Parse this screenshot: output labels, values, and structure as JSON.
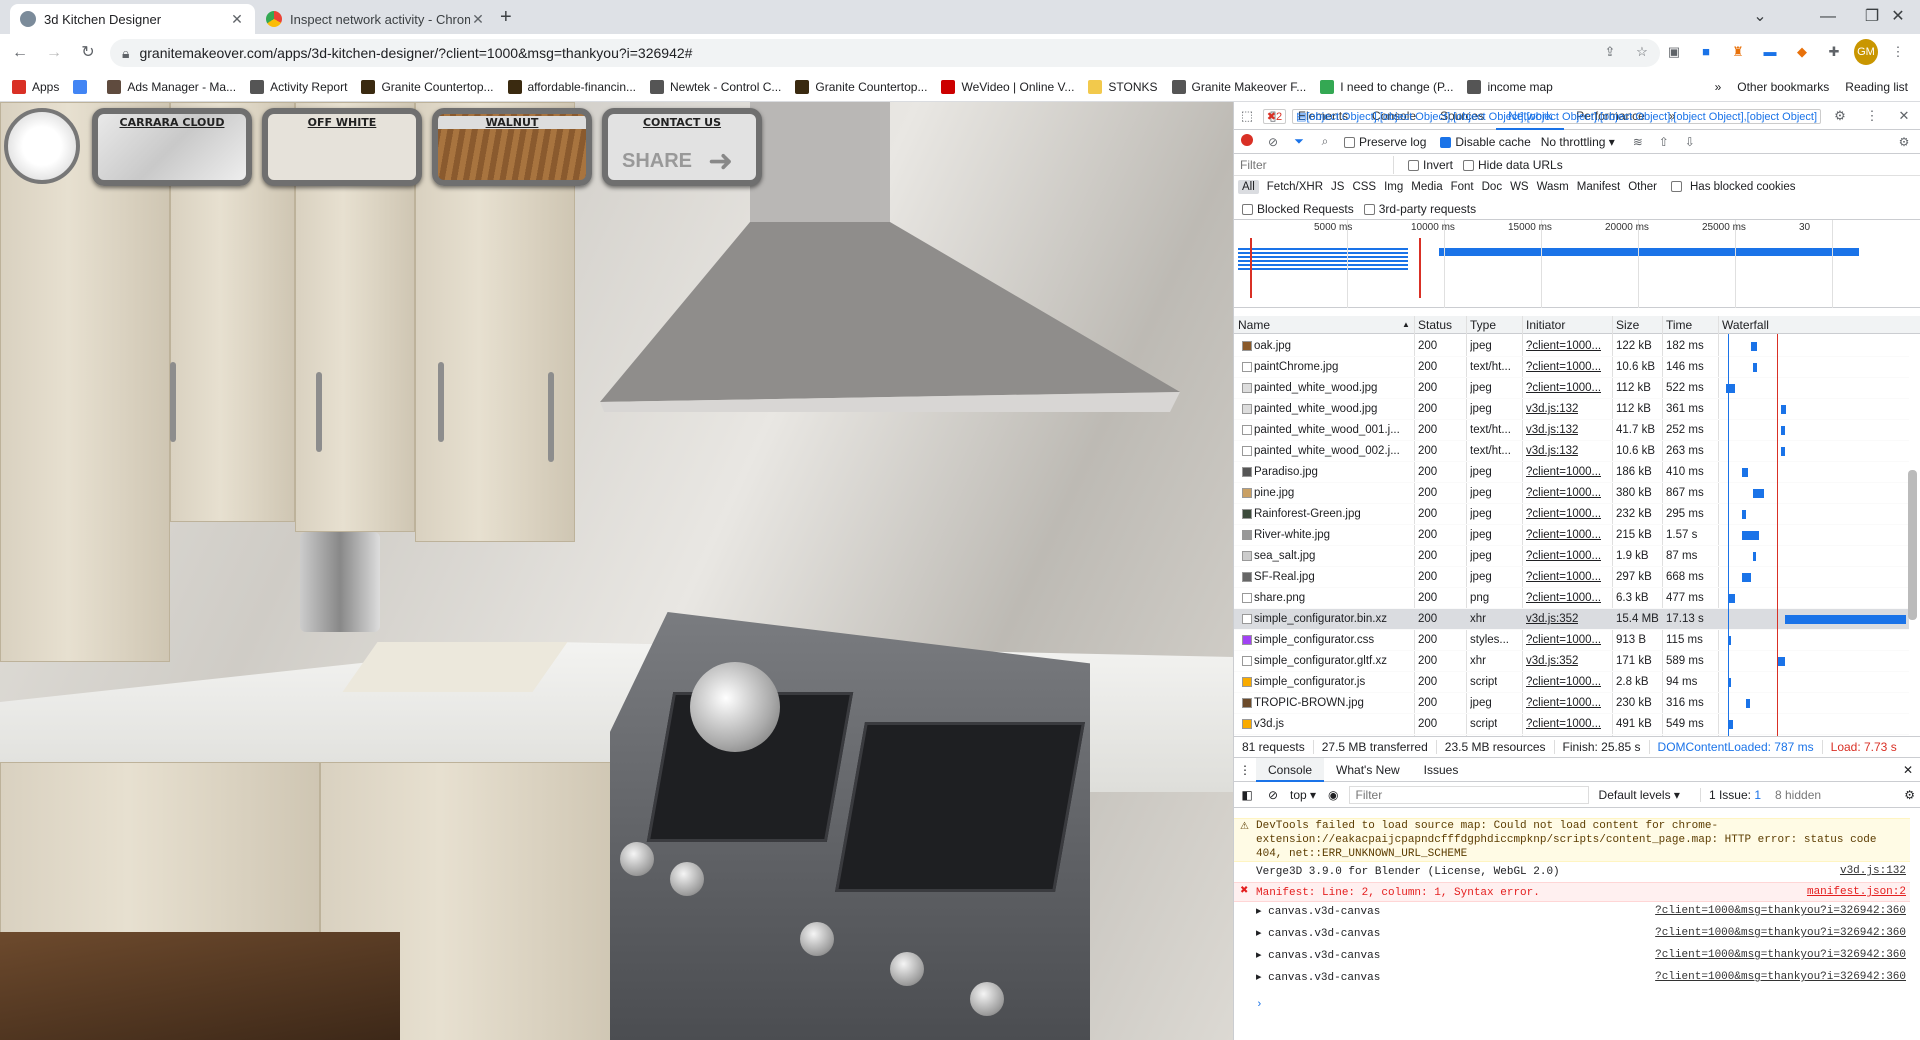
{
  "tabs": [
    {
      "title": "3d Kitchen Designer",
      "close": "✕"
    },
    {
      "title": "Inspect network activity - Chrome",
      "close": "✕"
    }
  ],
  "new_tab": "+",
  "window_controls": {
    "minimize": "⌄",
    "min": "—",
    "restore": "❐",
    "close": "✕"
  },
  "url": "granitemakeover.com/apps/3d-kitchen-designer/?client=1000&msg=thankyou?i=326942#",
  "bookmarks": [
    {
      "label": "Apps",
      "color": "#d93025"
    },
    {
      "label": "",
      "color": "#4285f4"
    },
    {
      "label": "Ads Manager - Ma...",
      "color": "#5f4b3e"
    },
    {
      "label": "Activity Report",
      "color": "#555"
    },
    {
      "label": "Granite Countertop...",
      "color": "#3a2a10"
    },
    {
      "label": "affordable-financin...",
      "color": "#3a2a10"
    },
    {
      "label": "Newtek - Control C...",
      "color": "#555"
    },
    {
      "label": "Granite Countertop...",
      "color": "#3a2a10"
    },
    {
      "label": "WeVideo | Online V...",
      "color": "#c00"
    },
    {
      "label": "STONKS",
      "color": "#f2c94c"
    },
    {
      "label": "Granite Makeover F...",
      "color": "#555"
    },
    {
      "label": "I need to change (P...",
      "color": "#34a853"
    },
    {
      "label": "income map",
      "color": "#555"
    }
  ],
  "bookmark_right": {
    "more": "»",
    "other": "Other bookmarks",
    "reading": "Reading list"
  },
  "scene": {
    "buttons": [
      {
        "label": "CARRARA CLOUD"
      },
      {
        "label": "OFF WHITE"
      },
      {
        "label": "WALNUT"
      },
      {
        "label": "CONTACT US",
        "extra": "SHARE"
      }
    ]
  },
  "devtools": {
    "tabs": [
      "Elements",
      "Console",
      "Sources",
      "Network",
      "Performance",
      "»"
    ],
    "active_tab": "Network",
    "errors": "2",
    "messages": [
      {
        "kind": "warn",
        "text": "DevTools failed to load source map: Could not load content for chrome-extension://eakacpaijcpapndcfffdgphdiccmpknp/scripts/content_page.map: HTTP error: status code 404, net::ERR_UNKNOWN_URL_SCHEME",
        "src": ""
      },
      {
        "kind": "info",
        "text": "Verge3D 3.9.0 for Blender (License, WebGL 2.0)",
        "src": "v3d.js:132"
      },
      {
        "kind": "err",
        "text": "Manifest: Line: 2, column: 1, Syntax error.",
        "src": "manifest.json:2"
      },
      {
        "kind": "info",
        "text": "▸ canvas.v3d-canvas",
        "src": "?client=1000&msg=thankyou?i=326942:360"
      },
      {
        "kind": "info",
        "text": "▸ canvas.v3d-canvas",
        "src": "?client=1000&msg=thankyou?i=326942:360"
      },
      {
        "kind": "info",
        "text": "▸ canvas.v3d-canvas",
        "src": "?client=1000&msg=thankyou?i=326942:360"
      },
      {
        "kind": "info",
        "text": "▸ canvas.v3d-canvas",
        "src": "?client=1000&msg=thankyou?i=326942:360"
      }
    ],
    "toolbar": {
      "preserve_log": "Preserve log",
      "disable_cache": "Disable cache",
      "throttling": "No throttling"
    },
    "filter_placeholder": "Filter",
    "invert": "Invert",
    "hide_data": "Hide data URLs",
    "types": [
      "All",
      "Fetch/XHR",
      "JS",
      "CSS",
      "Img",
      "Media",
      "Font",
      "Doc",
      "WS",
      "Wasm",
      "Manifest",
      "Other"
    ],
    "has_blocked": "Has blocked cookies",
    "blocked_requests": "Blocked Requests",
    "third_party": "3rd-party requests",
    "overview_ticks": [
      "5000 ms",
      "10000 ms",
      "15000 ms",
      "20000 ms",
      "25000 ms",
      "30"
    ],
    "columns": [
      "Name",
      "Status",
      "Type",
      "Initiator",
      "Size",
      "Time",
      "Waterfall"
    ],
    "rows": [
      {
        "name": "oak.jpg",
        "status": "200",
        "type": "jpeg",
        "initiator": "?client=1000...",
        "size": "122 kB",
        "time": "182 ms",
        "icon": "#8a5a2b",
        "wf_start": 0.16,
        "wf_len": 0.03
      },
      {
        "name": "paintChrome.jpg",
        "status": "200",
        "type": "text/ht...",
        "initiator": "?client=1000...",
        "size": "10.6 kB",
        "time": "146 ms",
        "icon": "#fff",
        "wf_start": 0.17,
        "wf_len": 0.02
      },
      {
        "name": "painted_white_wood.jpg",
        "status": "200",
        "type": "jpeg",
        "initiator": "?client=1000...",
        "size": "112 kB",
        "time": "522 ms",
        "icon": "#ddd",
        "wf_start": 0.02,
        "wf_len": 0.05
      },
      {
        "name": "painted_white_wood.jpg",
        "status": "200",
        "type": "jpeg",
        "initiator": "v3d.js:132",
        "size": "112 kB",
        "time": "361 ms",
        "icon": "#ddd",
        "wf_start": 0.32,
        "wf_len": 0.03
      },
      {
        "name": "painted_white_wood_001.j...",
        "status": "200",
        "type": "text/ht...",
        "initiator": "v3d.js:132",
        "size": "41.7 kB",
        "time": "252 ms",
        "icon": "#fff",
        "wf_start": 0.32,
        "wf_len": 0.02
      },
      {
        "name": "painted_white_wood_002.j...",
        "status": "200",
        "type": "text/ht...",
        "initiator": "v3d.js:132",
        "size": "10.6 kB",
        "time": "263 ms",
        "icon": "#fff",
        "wf_start": 0.32,
        "wf_len": 0.02
      },
      {
        "name": "Paradiso.jpg",
        "status": "200",
        "type": "jpeg",
        "initiator": "?client=1000...",
        "size": "186 kB",
        "time": "410 ms",
        "icon": "#555",
        "wf_start": 0.11,
        "wf_len": 0.03
      },
      {
        "name": "pine.jpg",
        "status": "200",
        "type": "jpeg",
        "initiator": "?client=1000...",
        "size": "380 kB",
        "time": "867 ms",
        "icon": "#c9a064",
        "wf_start": 0.17,
        "wf_len": 0.06
      },
      {
        "name": "Rainforest-Green.jpg",
        "status": "200",
        "type": "jpeg",
        "initiator": "?client=1000...",
        "size": "232 kB",
        "time": "295 ms",
        "icon": "#3b4a3a",
        "wf_start": 0.11,
        "wf_len": 0.02
      },
      {
        "name": "River-white.jpg",
        "status": "200",
        "type": "jpeg",
        "initiator": "?client=1000...",
        "size": "215 kB",
        "time": "1.57 s",
        "icon": "#999",
        "wf_start": 0.11,
        "wf_len": 0.09
      },
      {
        "name": "sea_salt.jpg",
        "status": "200",
        "type": "jpeg",
        "initiator": "?client=1000...",
        "size": "1.9 kB",
        "time": "87 ms",
        "icon": "#ccc",
        "wf_start": 0.17,
        "wf_len": 0.01
      },
      {
        "name": "SF-Real.jpg",
        "status": "200",
        "type": "jpeg",
        "initiator": "?client=1000...",
        "size": "297 kB",
        "time": "668 ms",
        "icon": "#666",
        "wf_start": 0.11,
        "wf_len": 0.05
      },
      {
        "name": "share.png",
        "status": "200",
        "type": "png",
        "initiator": "?client=1000...",
        "size": "6.3 kB",
        "time": "477 ms",
        "icon": "#fff",
        "wf_start": 0.03,
        "wf_len": 0.04
      },
      {
        "name": "simple_configurator.bin.xz",
        "status": "200",
        "type": "xhr",
        "initiator": "v3d.js:352",
        "size": "15.4 MB",
        "time": "17.13 s",
        "icon": "#fff",
        "wf_start": 0.34,
        "wf_len": 0.66,
        "selected": true
      },
      {
        "name": "simple_configurator.css",
        "status": "200",
        "type": "styles...",
        "initiator": "?client=1000...",
        "size": "913 B",
        "time": "115 ms",
        "icon": "#a142f4",
        "wf_start": 0.03,
        "wf_len": 0.01
      },
      {
        "name": "simple_configurator.gltf.xz",
        "status": "200",
        "type": "xhr",
        "initiator": "v3d.js:352",
        "size": "171 kB",
        "time": "589 ms",
        "icon": "#fff",
        "wf_start": 0.3,
        "wf_len": 0.04
      },
      {
        "name": "simple_configurator.js",
        "status": "200",
        "type": "script",
        "initiator": "?client=1000...",
        "size": "2.8 kB",
        "time": "94 ms",
        "icon": "#f9ab00",
        "wf_start": 0.03,
        "wf_len": 0.01
      },
      {
        "name": "TROPIC-BROWN.jpg",
        "status": "200",
        "type": "jpeg",
        "initiator": "?client=1000...",
        "size": "230 kB",
        "time": "316 ms",
        "icon": "#6b4a2a",
        "wf_start": 0.13,
        "wf_len": 0.02
      },
      {
        "name": "v3d.js",
        "status": "200",
        "type": "script",
        "initiator": "?client=1000...",
        "size": "491 kB",
        "time": "549 ms",
        "icon": "#f9ab00",
        "wf_start": 0.03,
        "wf_len": 0.03
      }
    ],
    "summary": {
      "requests": "81 requests",
      "transferred": "27.5 MB transferred",
      "resources": "23.5 MB resources",
      "finish": "Finish: 25.85 s",
      "dcl": "DOMContentLoaded: 787 ms",
      "load": "Load: 7.73 s"
    },
    "drawer_tabs": [
      "Console",
      "What's New",
      "Issues"
    ],
    "console_toolbar": {
      "context": "top",
      "filter": "Filter",
      "levels": "Default levels",
      "issues": "1 Issue:",
      "issue_count": "1",
      "hidden": "8 hidden"
    },
    "prompt": "›"
  }
}
